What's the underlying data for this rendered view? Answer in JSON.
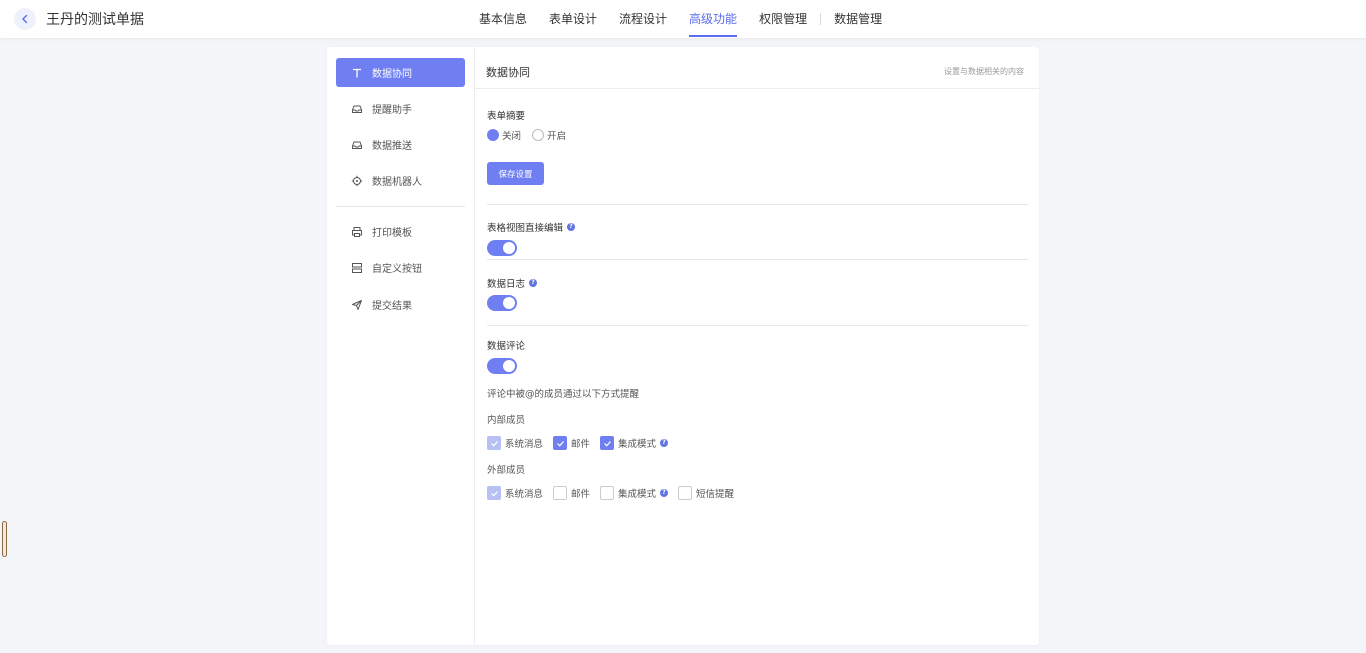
{
  "header": {
    "title": "王丹的测试单据",
    "tabs": [
      {
        "label": "基本信息"
      },
      {
        "label": "表单设计"
      },
      {
        "label": "流程设计"
      },
      {
        "label": "高级功能"
      },
      {
        "label": "权限管理"
      },
      {
        "label": "数据管理"
      }
    ],
    "active_tab": "高级功能"
  },
  "sidebar": {
    "items": [
      {
        "label": "数据协同",
        "icon": "text-t-icon"
      },
      {
        "label": "提醒助手",
        "icon": "inbox-icon"
      },
      {
        "label": "数据推送",
        "icon": "inbox-icon"
      },
      {
        "label": "数据机器人",
        "icon": "robot-icon"
      },
      {
        "label": "打印模板",
        "icon": "printer-icon"
      },
      {
        "label": "自定义按钮",
        "icon": "layout-icon"
      },
      {
        "label": "提交结果",
        "icon": "send-icon"
      }
    ],
    "active": "数据协同"
  },
  "panel": {
    "title": "数据协同",
    "hint": "设置与数据相关的内容",
    "summary": {
      "label": "表单摘要",
      "options": [
        "关闭",
        "开启"
      ],
      "selected": "关闭"
    },
    "save_label": "保存设置",
    "table_edit": {
      "label": "表格视图直接编辑",
      "enabled": true
    },
    "data_log": {
      "label": "数据日志",
      "enabled": true
    },
    "comments": {
      "label": "数据评论",
      "enabled": true,
      "notify_text": "评论中被@的成员通过以下方式提醒",
      "internal": {
        "label": "内部成员",
        "options": [
          {
            "label": "系统消息",
            "state": "checked-disabled"
          },
          {
            "label": "邮件",
            "state": "checked"
          },
          {
            "label": "集成模式",
            "state": "checked",
            "help": true
          }
        ]
      },
      "external": {
        "label": "外部成员",
        "options": [
          {
            "label": "系统消息",
            "state": "checked-disabled"
          },
          {
            "label": "邮件",
            "state": "unchecked"
          },
          {
            "label": "集成模式",
            "state": "unchecked",
            "help": true
          },
          {
            "label": "短信提醒",
            "state": "unchecked"
          }
        ]
      }
    }
  },
  "colors": {
    "accent": "#6f7ff2",
    "tab_active": "#5b6cf0",
    "background": "#f4f5f9"
  }
}
